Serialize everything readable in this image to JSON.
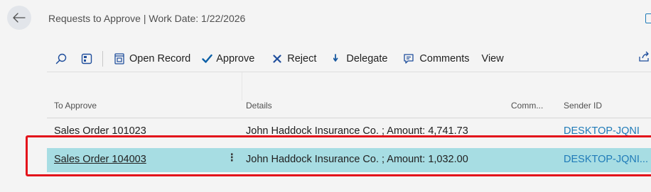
{
  "header": {
    "title": "Requests to Approve | Work Date: 1/22/2026"
  },
  "toolbar": {
    "open_record_label": "Open Record",
    "approve_label": "Approve",
    "reject_label": "Reject",
    "delegate_label": "Delegate",
    "comments_label": "Comments",
    "view_label": "View"
  },
  "table": {
    "columns": [
      "To Approve",
      "Details",
      "Comm...",
      "Sender ID"
    ],
    "rows": [
      {
        "to_approve": "Sales Order 101023",
        "details": "John Haddock Insurance Co. ; Amount: 4,741.73",
        "comments": "_",
        "sender": "DESKTOP-JQNI"
      },
      {
        "to_approve": "Sales Order 104003",
        "details": "John Haddock Insurance Co. ; Amount: 1,032.00",
        "comments": "",
        "sender": "DESKTOP-JQNI...",
        "selected": true
      }
    ]
  },
  "colors": {
    "accent": "#1f7bb8",
    "selected_row": "#a7dde3",
    "highlight": "#e3131b",
    "approve_check": "#0b5fa6",
    "reject_x": "#1f4e9c",
    "delegate_arrow": "#1a5aa0"
  },
  "icons": [
    "back-arrow-icon",
    "document-icon",
    "search-icon",
    "filter-pane-icon",
    "open-record-icon",
    "checkmark-icon",
    "x-icon",
    "delegate-arrow-icon",
    "comment-icon",
    "share-icon",
    "more-options-icon"
  ]
}
